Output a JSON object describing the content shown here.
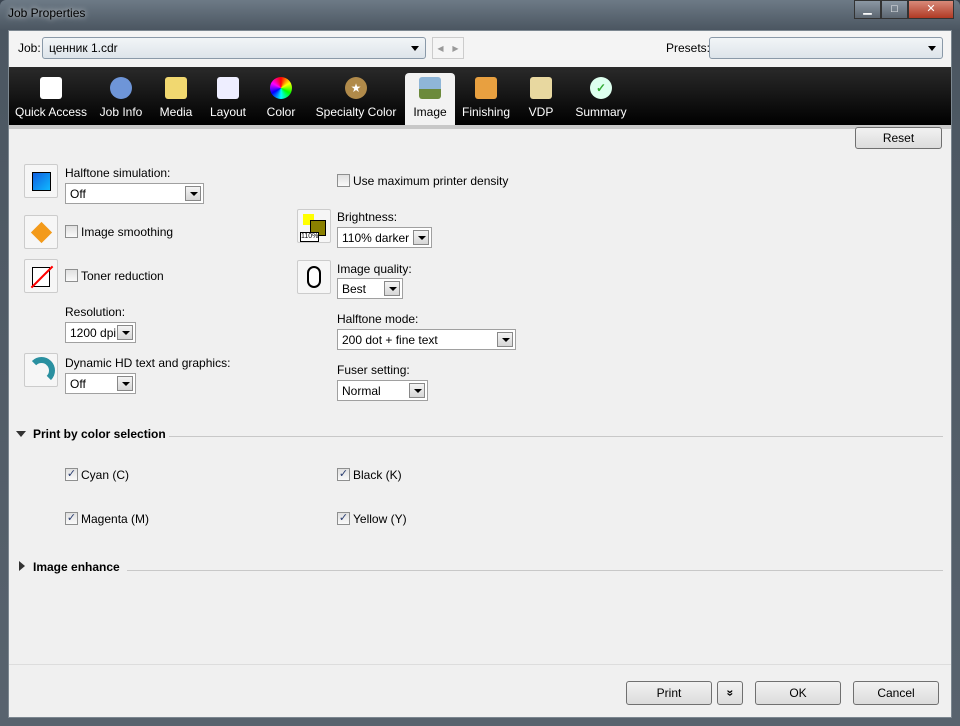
{
  "window": {
    "title": "Job Properties",
    "minimize": "▁",
    "maximize": "□",
    "close": "✕"
  },
  "job": {
    "label": "Job:",
    "value": "ценник 1.cdr",
    "presets_label": "Presets:",
    "presets_value": ""
  },
  "tabs": [
    {
      "label": "Quick Access"
    },
    {
      "label": "Job Info"
    },
    {
      "label": "Media"
    },
    {
      "label": "Layout"
    },
    {
      "label": "Color"
    },
    {
      "label": "Specialty Color"
    },
    {
      "label": "Image"
    },
    {
      "label": "Finishing"
    },
    {
      "label": "VDP"
    },
    {
      "label": "Summary"
    }
  ],
  "reset": "Reset",
  "image": {
    "halftone_sim_label": "Halftone simulation:",
    "halftone_sim_value": "Off",
    "image_smoothing": "Image smoothing",
    "toner_reduction": "Toner reduction",
    "resolution_label": "Resolution:",
    "resolution_value": "1200 dpi",
    "dynamic_hd_label": "Dynamic HD text and graphics:",
    "dynamic_hd_value": "Off",
    "max_density": "Use maximum printer density",
    "brightness_label": "Brightness:",
    "brightness_value": "110% darker",
    "brightness_icon_text": "110%",
    "quality_label": "Image quality:",
    "quality_value": "Best",
    "halftone_mode_label": "Halftone mode:",
    "halftone_mode_value": "200 dot + fine text",
    "fuser_label": "Fuser setting:",
    "fuser_value": "Normal"
  },
  "color_selection": {
    "title": "Print by color selection",
    "items": [
      "Cyan (C)",
      "Black (K)",
      "Magenta (M)",
      "Yellow (Y)"
    ]
  },
  "image_enhance": {
    "title": "Image enhance"
  },
  "footer": {
    "print": "Print",
    "more": "»",
    "ok": "OK",
    "cancel": "Cancel"
  }
}
